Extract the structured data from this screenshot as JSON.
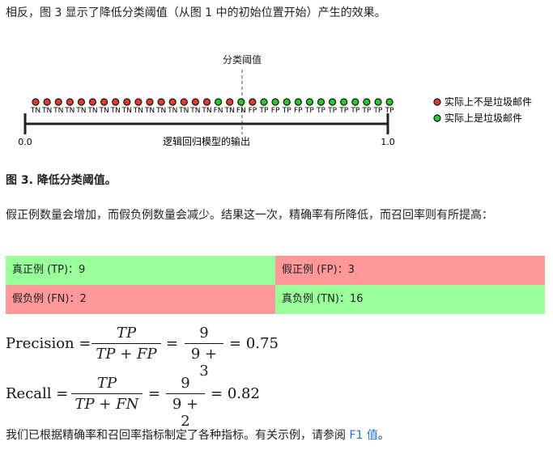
{
  "intro": "相反，图 3 显示了降低分类阈值（从图 1 中的初始位置开始）产生的效果。",
  "figure": {
    "threshold_label": "分类阈值",
    "axis_min": "0.0",
    "axis_max": "1.0",
    "axis_label": "逻辑回归模型的输出",
    "dots": [
      "red",
      "red",
      "red",
      "red",
      "red",
      "red",
      "red",
      "red",
      "red",
      "red",
      "red",
      "red",
      "red",
      "red",
      "red",
      "red",
      "green",
      "red",
      "green",
      "red",
      "green",
      "green",
      "green",
      "green",
      "green",
      "green",
      "green",
      "green",
      "green",
      "green",
      "green",
      "green"
    ],
    "labels": [
      "TN",
      "TN",
      "TN",
      "TN",
      "TN",
      "TN",
      "TN",
      "TN",
      "TN",
      "TN",
      "TN",
      "TN",
      "TN",
      "TN",
      "TN",
      "TN",
      "FN",
      "TN",
      "FN",
      "FP",
      "TP",
      "FP",
      "TP",
      "FP",
      "TP",
      "TP",
      "TP",
      "TP",
      "TP",
      "TP",
      "TP",
      "TP"
    ],
    "legend": [
      {
        "label": "实际上不是垃圾邮件",
        "color": "#e53935"
      },
      {
        "label": "实际上是垃圾邮件",
        "color": "#22cc22"
      }
    ]
  },
  "caption": "图 3. 降低分类阈值。",
  "paragraph": "假正例数量会增加，而假负例数量会减少。结果这一次，精确率有所降低，而召回率则有所提高：",
  "confusion": {
    "tp": "真正例 (TP)：9",
    "fp": "假正例 (FP)：3",
    "fn": "假负例 (FN)：2",
    "tn": "真负例 (TN)：16"
  },
  "precision": {
    "name": "Precision",
    "num": "TP",
    "den": "TP + FP",
    "num2": "9",
    "den2": "9 + 3",
    "result": "0.75"
  },
  "recall": {
    "name": "Recall",
    "num": "TP",
    "den": "TP + FN",
    "num2": "9",
    "den2": "9 + 2",
    "result": "0.82"
  },
  "footer": {
    "text": "我们已根据精确率和召回率指标制定了各种指标。有关示例，请参阅 ",
    "link": "F1 值",
    "end": "。"
  }
}
